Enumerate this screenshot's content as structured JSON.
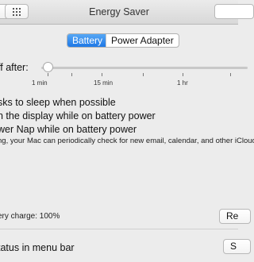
{
  "window": {
    "title": "Energy Saver"
  },
  "toolbar": {
    "show_all_icon": "grid-icon"
  },
  "tabs": [
    {
      "label": "Battery",
      "selected": true
    },
    {
      "label": "Power Adapter",
      "selected": false
    }
  ],
  "display_sleep": {
    "label": "ff after:",
    "ticks": [
      "1 min",
      "15 min",
      "1 hr"
    ],
    "value": "1 min"
  },
  "options": {
    "sleep": "sks to sleep when possible",
    "dim": "n the display while on battery power",
    "powernap": "wer Nap while on battery power",
    "powernap_desc": "ng, your Mac can periodically check for new email, calendar, and other iCloud"
  },
  "battery_charge": "ery charge: 100%",
  "buttons": {
    "restore": "Re",
    "settings": "S"
  },
  "status_menu": "tatus in menu bar",
  "colors": {
    "accent": "#1e78e6",
    "window_bg": "#ececec"
  }
}
